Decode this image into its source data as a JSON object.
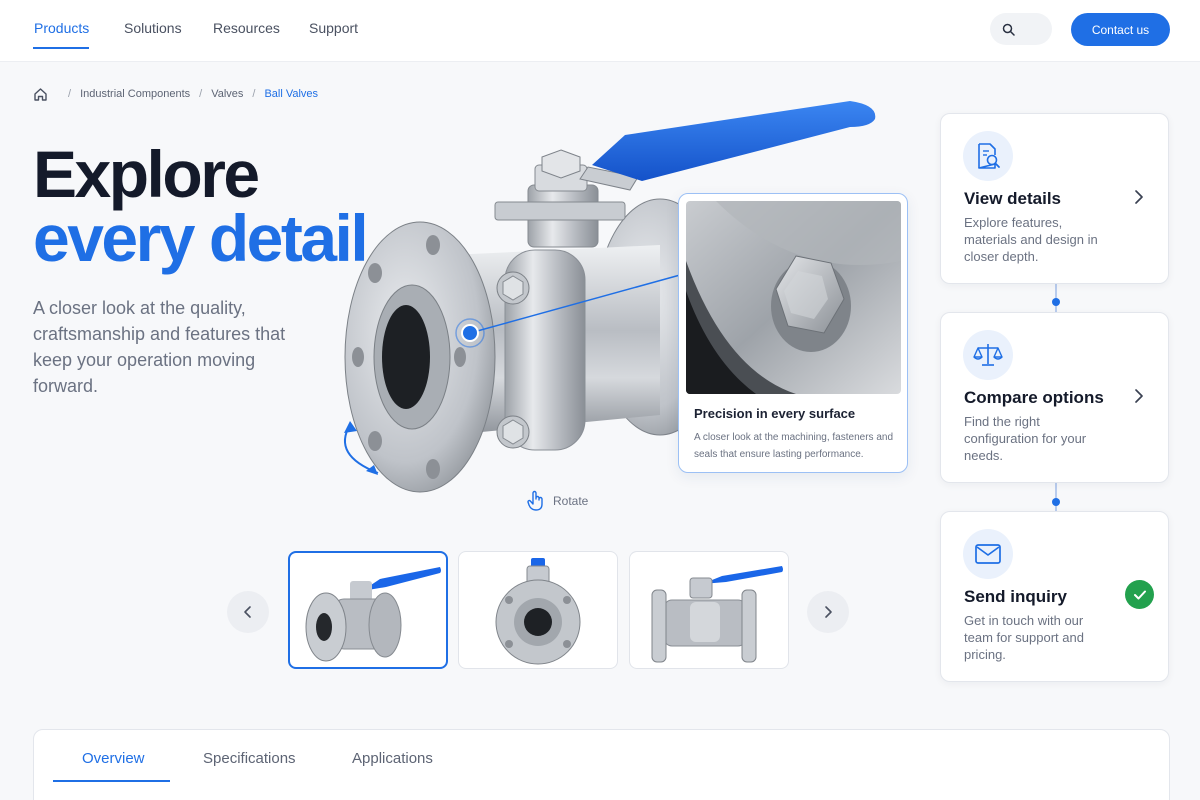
{
  "nav": {
    "items": [
      {
        "label": "Products"
      },
      {
        "label": "Solutions"
      },
      {
        "label": "Resources"
      },
      {
        "label": "Support"
      }
    ],
    "contact_label": "Contact us",
    "search_icon": "search-icon"
  },
  "breadcrumb": {
    "home_icon": "home-icon",
    "items": [
      "Industrial Components",
      "Valves",
      "Ball Valves"
    ]
  },
  "hero": {
    "title_line1": "Explore",
    "title_line2": "every detail",
    "subtitle": "A closer look at the quality, craftsmanship and features that keep your operation moving forward."
  },
  "viewer": {
    "rotate_label": "Rotate",
    "rotate_icon": "hand-pointer-icon",
    "callout_title": "Precision in every surface",
    "callout_desc": "A closer look at the machining, fasteners and seals that ensure lasting performance."
  },
  "thumbnails": {
    "selected_index": 0,
    "prev_icon": "chevron-left-icon",
    "next_icon": "chevron-right-icon"
  },
  "cards": [
    {
      "title": "View details",
      "desc": "Explore features, materials and design in closer depth.",
      "icon": "document-search-icon"
    },
    {
      "title": "Compare options",
      "desc": "Find the right configuration for your needs.",
      "icon": "scales-icon"
    },
    {
      "title": "Send inquiry",
      "desc": "Get in touch with our team for support and pricing.",
      "icon": "envelope-icon",
      "status_icon": "check-icon"
    }
  ],
  "tabs": [
    {
      "label": "Overview"
    },
    {
      "label": "Specifications"
    },
    {
      "label": "Applications"
    }
  ],
  "colors": {
    "accent": "#1f6fe5",
    "success": "#23a14e",
    "handle": "#1a66e8"
  }
}
